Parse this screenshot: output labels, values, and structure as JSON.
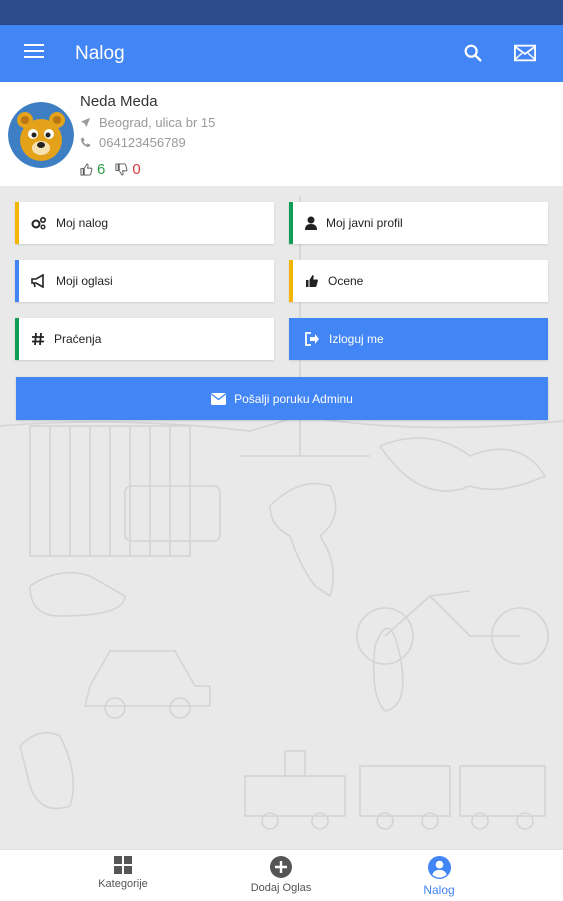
{
  "appbar": {
    "title": "Nalog"
  },
  "profile": {
    "name": "Neda Meda",
    "address": "Beograd, ulica br 15",
    "phone": "064123456789",
    "likes": "6",
    "dislikes": "0"
  },
  "menu": {
    "moj_nalog": "Moj nalog",
    "javni_profil": "Moj javni profil",
    "oglasi": "Moji oglasi",
    "ocene": "Ocene",
    "pracenja": "Praćenja",
    "izloguj": "Izloguj me",
    "admin": "Pošalji poruku Adminu"
  },
  "bottom_nav": {
    "kategorije": "Kategorije",
    "dodaj": "Dodaj Oglas",
    "nalog": "Nalog"
  },
  "colors": {
    "primary": "#4285f4",
    "yellow": "#f4b400",
    "green": "#0f9d58",
    "blue": "#4285f4"
  }
}
